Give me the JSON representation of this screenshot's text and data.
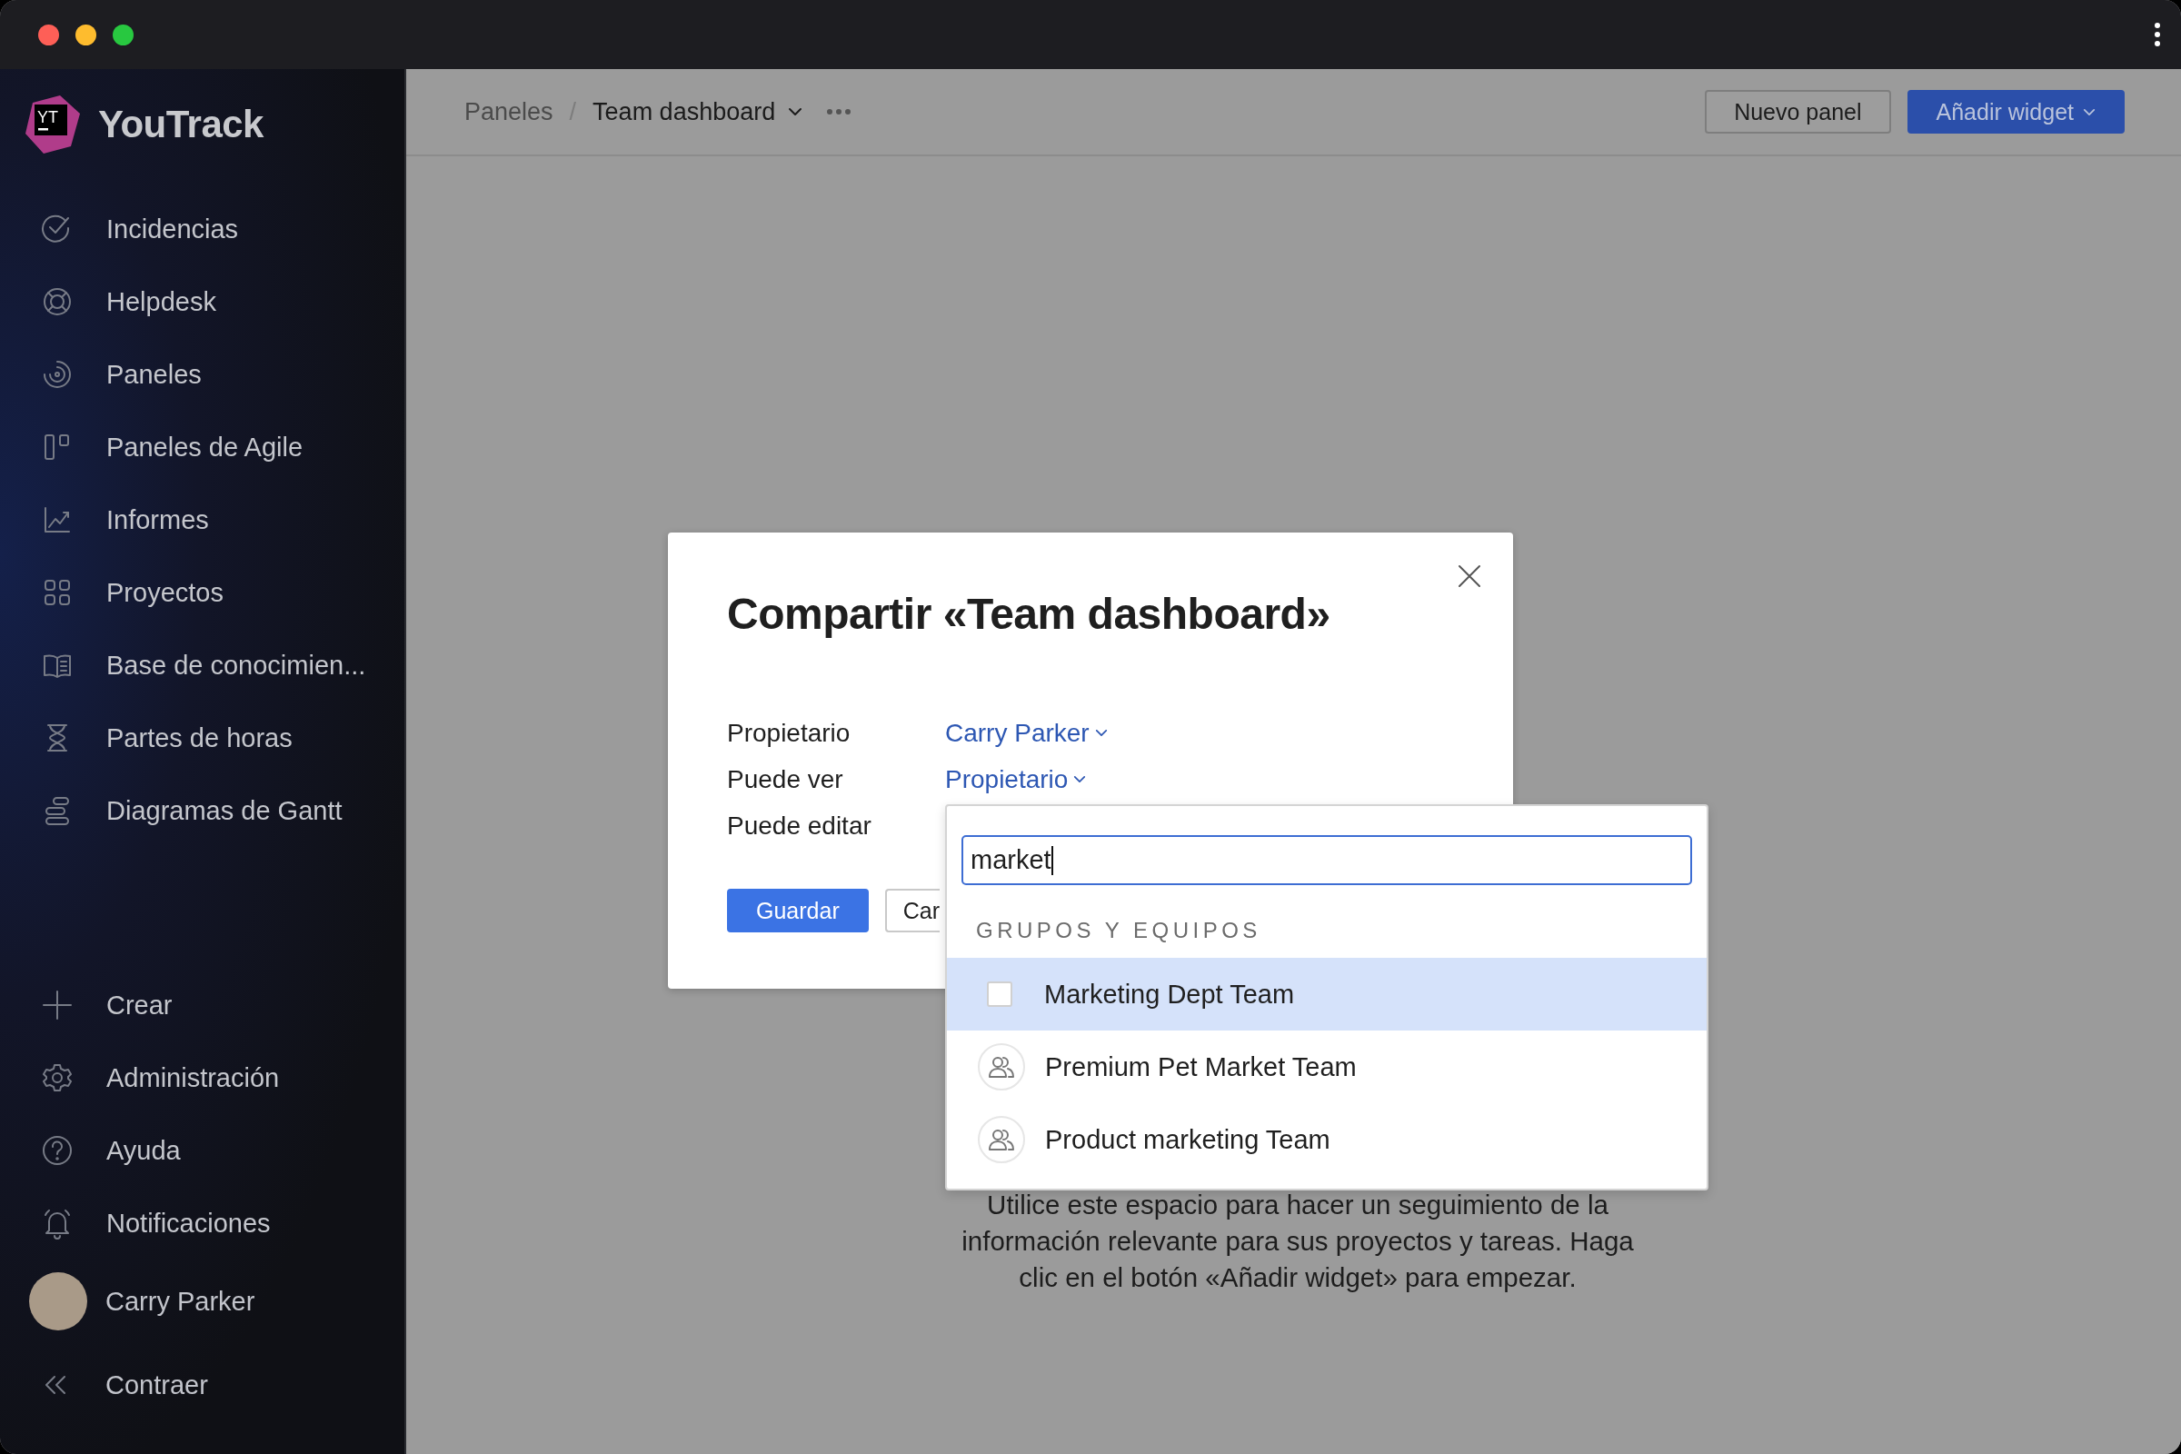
{
  "sidebar": {
    "logo_mark": "YT",
    "logo_text": "YouTrack",
    "nav_items": [
      {
        "label": "Incidencias"
      },
      {
        "label": "Helpdesk"
      },
      {
        "label": "Paneles"
      },
      {
        "label": "Paneles de Agile"
      },
      {
        "label": "Informes"
      },
      {
        "label": "Proyectos"
      },
      {
        "label": "Base de conocimien..."
      },
      {
        "label": "Partes de horas"
      },
      {
        "label": "Diagramas de Gantt"
      }
    ],
    "bottom_items": [
      {
        "label": "Crear"
      },
      {
        "label": "Administración"
      },
      {
        "label": "Ayuda"
      },
      {
        "label": "Notificaciones"
      }
    ],
    "user": {
      "name": "Carry Parker"
    },
    "collapse": "Contraer"
  },
  "header": {
    "breadcrumb": [
      "Paneles",
      "Team dashboard"
    ],
    "separator": "/",
    "buttons": [
      {
        "label": "Nuevo panel",
        "kind": "secondary"
      },
      {
        "label": "Añadir widget",
        "kind": "primary"
      }
    ]
  },
  "empty_state": "Utilice este espacio para hacer un seguimiento de la información relevante para sus proyectos y tareas. Haga clic en el botón «Añadir widget» para empezar.",
  "dialog": {
    "title": "Compartir «Team dashboard»",
    "fields": [
      {
        "label": "Propietario",
        "value": "Carry Parker"
      },
      {
        "label": "Puede ver",
        "value": "Propietario"
      },
      {
        "label": "Puede editar"
      }
    ],
    "buttons": [
      {
        "label": "Guardar",
        "kind": "primary"
      },
      {
        "label": "Car",
        "kind": "secondary"
      }
    ]
  },
  "dropdown": {
    "search": "market",
    "section": "GRUPOS Y EQUIPOS",
    "items": [
      {
        "label": "Marketing Dept Team",
        "selected": true,
        "checked": false
      },
      {
        "label": "Premium Pet Market Team",
        "selected": false,
        "checked": false
      },
      {
        "label": "Product marketing Team",
        "selected": false,
        "checked": false
      }
    ]
  }
}
